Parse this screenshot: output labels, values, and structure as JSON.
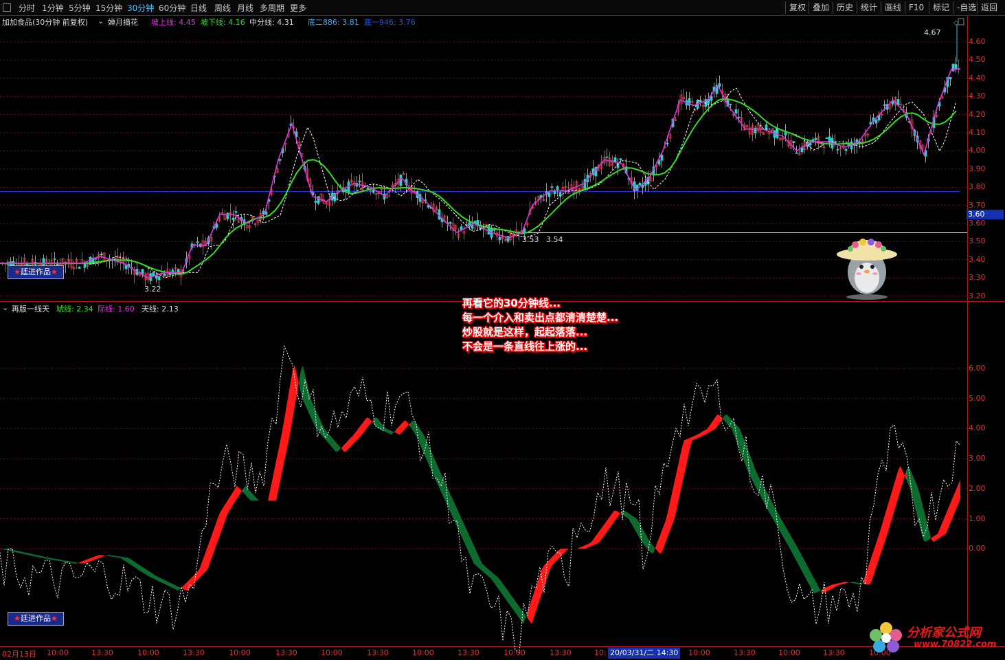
{
  "toolbar": {
    "periods": [
      "分时",
      "1分钟",
      "5分钟",
      "15分钟",
      "30分钟",
      "60分钟",
      "日线",
      "周线",
      "月线",
      "多周期",
      "更多"
    ],
    "active_period": "30分钟",
    "actions": [
      "复权",
      "叠加",
      "历史",
      "统计",
      "画线",
      "F10",
      "标记",
      "-自选",
      "返回"
    ]
  },
  "upper": {
    "stock_title": "加加食品(30分钟 前复权)",
    "indicator": "婵月摘花",
    "slope_up_label": "坡上线: 4.45",
    "slope_down_label": "坡下线: 4.16",
    "mid_label": "中分线: 4.31",
    "low2_label": "底二886: 3.81",
    "low1_label": "底一946: 3.76",
    "price_axis": [
      "4.60",
      "4.50",
      "4.40",
      "4.30",
      "4.20",
      "4.10",
      "4.00",
      "3.90",
      "3.80",
      "3.70",
      "3.60",
      "3.50",
      "3.40",
      "3.30",
      "3.20"
    ],
    "current_price": "3.60",
    "high_marker": "4.67",
    "low_marker": "3.22",
    "mark_left": "3.53",
    "mark_right": "3.54",
    "badge": "廷进作品"
  },
  "lower": {
    "indicator": "再版一线天",
    "tiger_label": "虓线: 2.34",
    "edge_label": "际线: 1.60",
    "sky_label": "天线: 2.13",
    "axis": [
      "6.00",
      "5.00",
      "4.00",
      "3.00",
      "2.00",
      "1.00",
      "0.00"
    ],
    "badge": "廷进作品"
  },
  "annotation": {
    "line1": "再看它的30分钟线...",
    "line2": "每一个介入和卖出点都清清楚楚...",
    "line3": "炒股就是这样，起起落落...",
    "line4": "不会是一条直线往上涨的..."
  },
  "xaxis": {
    "ticks": [
      "02月13日",
      "10:00",
      "13:30",
      "10:00",
      "13:30",
      "10:00",
      "13:30",
      "10:00",
      "13:30",
      "10:00",
      "13:30",
      "10:00",
      "13:30",
      "10:",
      "20/03/31/二 14:30",
      "10:00",
      "13:30",
      "10:00",
      "13:30",
      "10:00"
    ],
    "cursor_date": "20/03/31/二 14:30"
  },
  "watermark": {
    "site_name": "分析家公式网",
    "site_url": "www.70822.com"
  },
  "colors": {
    "up": "#ff1a1a",
    "down": "#0e6b30",
    "magenta": "#e033e0",
    "green": "#33dd22",
    "axis_red": "#cc2222"
  }
}
